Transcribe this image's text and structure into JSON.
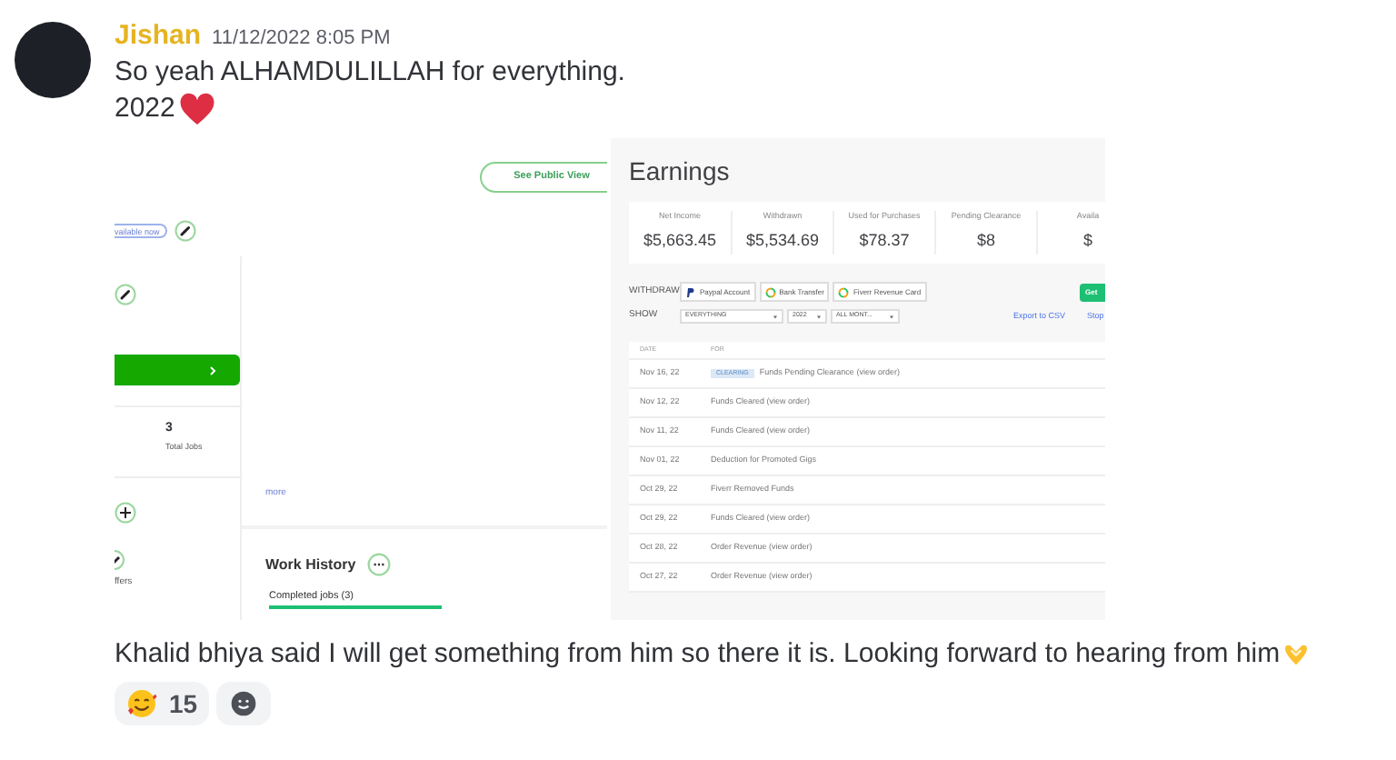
{
  "message": {
    "author": "Jishan",
    "timestamp": "11/12/2022 8:05 PM",
    "lines": [
      "So yeah ALHAMDULILLAH for everything.",
      "2022"
    ],
    "profile_screenshot": {
      "see_public_view": "See Public View",
      "availability": "vailable now",
      "total_jobs": {
        "value": "3",
        "label": "Total Jobs"
      },
      "more_link": "more",
      "offers_label": "ffers",
      "work_history": "Work History",
      "completed_tab": "Completed jobs (3)"
    },
    "earnings_screenshot": {
      "title": "Earnings",
      "stats": [
        {
          "label": "Net Income",
          "value": "$5,663.45"
        },
        {
          "label": "Withdrawn",
          "value": "$5,534.69"
        },
        {
          "label": "Used for Purchases",
          "value": "$78.37"
        },
        {
          "label": "Pending Clearance",
          "value": "$8"
        },
        {
          "label": "Availa",
          "value": "$"
        }
      ],
      "withdraw_label": "WITHDRAW",
      "withdraw_options": [
        {
          "label": "Paypal Account",
          "kind": "paypal"
        },
        {
          "label": "Bank Transfer",
          "kind": "ring"
        },
        {
          "label": "Fiverr Revenue Card",
          "kind": "ring"
        }
      ],
      "get_button": "Get",
      "show_label": "SHOW",
      "filters": [
        "EVERYTHING",
        "2022",
        "ALL MONT..."
      ],
      "export_link": "Export to CSV",
      "stop_link": "Stop",
      "columns": [
        "DATE",
        "FOR"
      ],
      "rows": [
        {
          "date": "Nov 16, 22",
          "badge": "CLEARING",
          "for": "Funds Pending Clearance (view order)"
        },
        {
          "date": "Nov 12, 22",
          "for": "Funds Cleared (view order)"
        },
        {
          "date": "Nov 11, 22",
          "for": "Funds Cleared (view order)"
        },
        {
          "date": "Nov 01, 22",
          "for": "Deduction for Promoted Gigs"
        },
        {
          "date": "Oct 29, 22",
          "for": "Fiverr Removed Funds"
        },
        {
          "date": "Oct 29, 22",
          "for": "Funds Cleared (view order)"
        },
        {
          "date": "Oct 28, 22",
          "for": "Order Revenue (view order)"
        },
        {
          "date": "Oct 27, 22",
          "for": "Order Revenue (view order)"
        }
      ]
    },
    "caption": "Khalid bhiya said I will get something from him so there it is. Looking forward to hearing from him",
    "reactions": [
      {
        "count": "15"
      }
    ]
  }
}
